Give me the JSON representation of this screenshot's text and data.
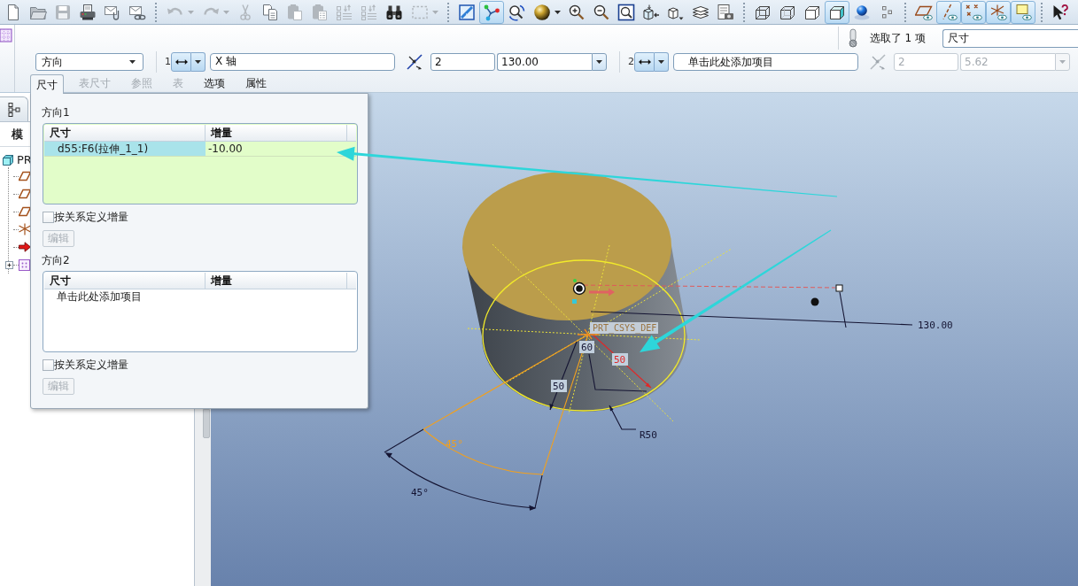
{
  "toolbar": {
    "groups": [
      [
        {
          "kind": "new",
          "dropdown": false,
          "selected": false,
          "disabled": false
        },
        {
          "kind": "open",
          "dropdown": false,
          "selected": false,
          "disabled": false
        },
        {
          "kind": "save",
          "dropdown": false,
          "selected": false,
          "disabled": true
        },
        {
          "kind": "print",
          "dropdown": false,
          "selected": false,
          "disabled": false
        },
        {
          "kind": "mail",
          "dropdown": false,
          "selected": false,
          "disabled": false
        },
        {
          "kind": "mail-link",
          "dropdown": false,
          "selected": false,
          "disabled": false
        }
      ],
      [
        {
          "kind": "undo",
          "dropdown": true,
          "selected": false,
          "disabled": true
        },
        {
          "kind": "redo",
          "dropdown": true,
          "selected": false,
          "disabled": true
        },
        {
          "kind": "cut",
          "dropdown": false,
          "selected": false,
          "disabled": true
        },
        {
          "kind": "copy",
          "dropdown": false,
          "selected": false,
          "disabled": false
        },
        {
          "kind": "paste",
          "dropdown": false,
          "selected": false,
          "disabled": true
        },
        {
          "kind": "paste-special",
          "dropdown": false,
          "selected": false,
          "disabled": true
        },
        {
          "kind": "regenerate",
          "dropdown": false,
          "selected": false,
          "disabled": true
        },
        {
          "kind": "regenerate-manager",
          "dropdown": false,
          "selected": false,
          "disabled": true
        },
        {
          "kind": "find",
          "dropdown": false,
          "selected": false,
          "disabled": false
        },
        {
          "kind": "box-select",
          "dropdown": true,
          "selected": false,
          "disabled": true
        }
      ],
      [
        {
          "kind": "sketch-display",
          "dropdown": false,
          "selected": false,
          "disabled": false
        },
        {
          "kind": "datum-display",
          "dropdown": false,
          "selected": true,
          "disabled": false
        },
        {
          "kind": "spin-center",
          "dropdown": false,
          "selected": false,
          "disabled": false
        },
        {
          "kind": "appearance-sphere",
          "dropdown": true,
          "selected": false,
          "disabled": false
        },
        {
          "kind": "zoom-in",
          "dropdown": false,
          "selected": false,
          "disabled": false
        },
        {
          "kind": "zoom-out",
          "dropdown": false,
          "selected": false,
          "disabled": false
        },
        {
          "kind": "refit",
          "dropdown": false,
          "selected": false,
          "disabled": false
        },
        {
          "kind": "reorient",
          "dropdown": false,
          "selected": false,
          "disabled": false
        },
        {
          "kind": "saved-views",
          "dropdown": false,
          "selected": false,
          "disabled": false
        },
        {
          "kind": "layers",
          "dropdown": false,
          "selected": false,
          "disabled": false
        },
        {
          "kind": "model-setup",
          "dropdown": false,
          "selected": false,
          "disabled": false
        }
      ],
      [
        {
          "kind": "wireframe",
          "dropdown": false,
          "selected": false,
          "disabled": false
        },
        {
          "kind": "hidden-line",
          "dropdown": false,
          "selected": false,
          "disabled": false
        },
        {
          "kind": "no-hidden",
          "dropdown": false,
          "selected": false,
          "disabled": false
        },
        {
          "kind": "shading",
          "dropdown": false,
          "selected": true,
          "disabled": false
        },
        {
          "kind": "scene",
          "dropdown": false,
          "selected": false,
          "disabled": false
        },
        {
          "kind": "small-squares",
          "dropdown": false,
          "selected": false,
          "disabled": false
        }
      ],
      [
        {
          "kind": "plane-display",
          "dropdown": false,
          "selected": false,
          "disabled": false
        },
        {
          "kind": "axis-display",
          "dropdown": false,
          "selected": true,
          "disabled": false
        },
        {
          "kind": "point-display",
          "dropdown": false,
          "selected": true,
          "disabled": false
        },
        {
          "kind": "csys-display",
          "dropdown": false,
          "selected": true,
          "disabled": false
        },
        {
          "kind": "annotation-display",
          "dropdown": false,
          "selected": true,
          "disabled": false
        }
      ],
      [
        {
          "kind": "context-help",
          "dropdown": false,
          "selected": false,
          "disabled": false
        }
      ]
    ]
  },
  "dashboard": {
    "type_dropdown": {
      "value": "方向"
    },
    "directions": [
      {
        "number": "1",
        "reference": {
          "value": "X 轴"
        },
        "count": {
          "value": "2"
        },
        "spacing": {
          "value": "130.00"
        },
        "disabled": false
      },
      {
        "number": "2",
        "reference": {
          "placeholder": "单击此处添加项目"
        },
        "count": {
          "value": "2"
        },
        "spacing": {
          "value": "5.62"
        },
        "disabled": true
      }
    ],
    "selection_status": "选取了 1 项",
    "filter": {
      "value": "尺寸"
    },
    "tabs": [
      {
        "label": "尺寸",
        "selected": true,
        "disabled": false
      },
      {
        "label": "表尺寸",
        "selected": false,
        "disabled": true
      },
      {
        "label": "参照",
        "selected": false,
        "disabled": true
      },
      {
        "label": "表",
        "selected": false,
        "disabled": true
      },
      {
        "label": "选项",
        "selected": false,
        "disabled": false
      },
      {
        "label": "属性",
        "selected": false,
        "disabled": false
      }
    ]
  },
  "navigator": {
    "header": "模",
    "tree": [
      {
        "label": "PR",
        "kind": "part",
        "children": [
          {
            "kind": "plane"
          },
          {
            "kind": "plane"
          },
          {
            "kind": "plane"
          },
          {
            "kind": "csys"
          },
          {
            "kind": "insert-marker"
          },
          {
            "kind": "feature",
            "expanded": false
          }
        ]
      }
    ]
  },
  "dimension_panel": {
    "sections": [
      {
        "title": "方向1",
        "active": true,
        "columns": [
          "尺寸",
          "增量"
        ],
        "rows": [
          {
            "cells": [
              "d55:F6(拉伸_1_1)",
              "-10.00"
            ],
            "selected": true
          }
        ],
        "relation": {
          "label": "按关系定义增量",
          "checked": false
        },
        "edit_button": {
          "label": "编辑",
          "disabled": true
        }
      },
      {
        "title": "方向2",
        "active": false,
        "columns": [
          "尺寸",
          "增量"
        ],
        "placeholder": "单击此处添加项目",
        "relation": {
          "label": "按关系定义增量",
          "checked": false
        },
        "edit_button": {
          "label": "编辑",
          "disabled": true
        }
      }
    ]
  },
  "viewport": {
    "labels": [
      {
        "text": "PRT_CSYS_DEF",
        "color": "#9a7440"
      },
      {
        "text": "130.00",
        "color": "#141432"
      },
      {
        "text": "60",
        "color": "#141432"
      },
      {
        "text": "50",
        "color": "#e02828"
      },
      {
        "text": "50",
        "color": "#141432"
      },
      {
        "text": "R50",
        "color": "#141432"
      },
      {
        "text": "45°",
        "color": "#f0a020"
      },
      {
        "text": "45°",
        "color": "#141432"
      }
    ]
  }
}
